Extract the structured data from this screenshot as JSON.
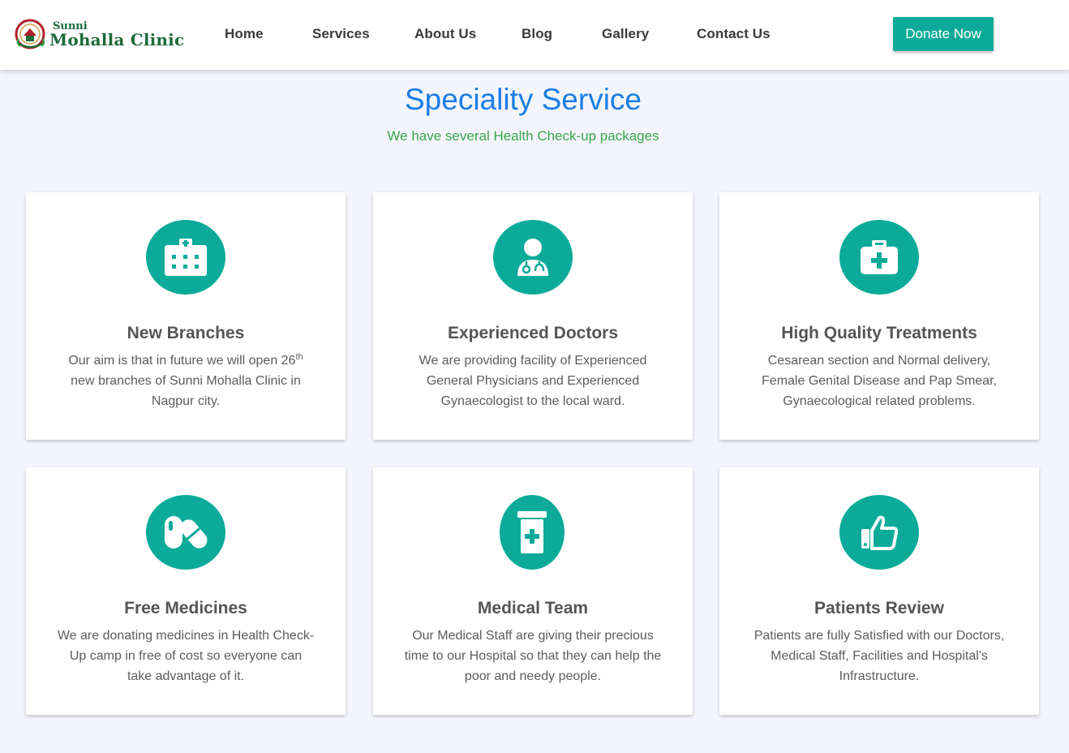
{
  "header": {
    "logo": {
      "top": "Sunni",
      "bottom": "Mohalla Clinic"
    },
    "nav": [
      "Home",
      "Services",
      "About Us",
      "Blog",
      "Gallery",
      "Contact Us"
    ],
    "donate_label": "Donate Now"
  },
  "section": {
    "title": "Speciality Service",
    "subtitle": "We have several Health Check-up packages"
  },
  "cards": [
    {
      "icon": "hospital-icon",
      "title": "New Branches",
      "text_before": "Our aim is that in future we will open 26",
      "text_sup": "th",
      "text_after": " new branches of Sunni Mohalla Clinic in Nagpur city."
    },
    {
      "icon": "doctor-icon",
      "title": "Experienced Doctors",
      "text": "We are providing facility of Experienced General Physicians and Experienced Gynaecologist to the local ward."
    },
    {
      "icon": "medical-kit-icon",
      "title": "High Quality Treatments",
      "text": "Cesarean section and Normal delivery, Female Genital Disease and Pap Smear, Gynaecological related problems."
    },
    {
      "icon": "pills-icon",
      "title": "Free Medicines",
      "text": "We are donating medicines in Health Check-Up camp in free of cost so everyone can take advantage of it."
    },
    {
      "icon": "prescription-bottle-icon",
      "title": "Medical Team",
      "text": "Our Medical Staff are giving their precious time to our Hospital so that they can help the poor and needy people."
    },
    {
      "icon": "thumbs-up-icon",
      "title": "Patients Review",
      "text": "Patients are fully Satisfied with our Doctors, Medical Staff, Facilities and Hospital's Infrastructure."
    }
  ],
  "colors": {
    "accent": "#0cab99",
    "title_blue": "#1a7ee6",
    "subtitle_green": "#3aa64a",
    "background": "#f4f5fc"
  }
}
